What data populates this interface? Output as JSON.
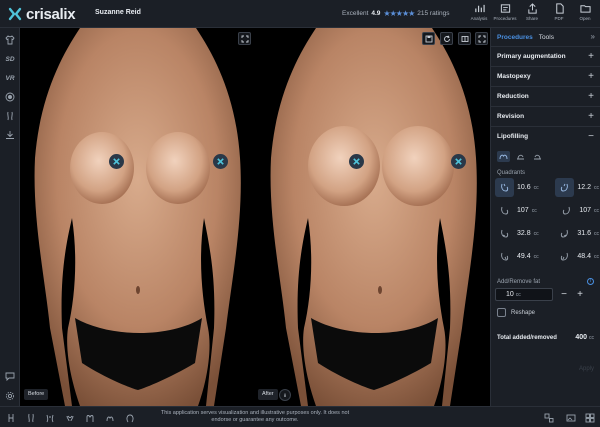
{
  "app": {
    "brand": "crisalix",
    "patient_name": "Suzanne Reid"
  },
  "rating": {
    "label": "Excellent",
    "score": "4.9",
    "stars": "★★★★★",
    "count": "215 ratings"
  },
  "toolbar": {
    "analysis": "Analysis",
    "procedures": "Procedures",
    "share": "Share",
    "pdf": "PDF",
    "open": "Open"
  },
  "leftbar": {
    "sd": "SD",
    "vr": "VR"
  },
  "viewer": {
    "before_label": "Before",
    "after_label": "After"
  },
  "panel": {
    "tabs": [
      "Procedures",
      "Tools"
    ],
    "collapse_glyph": "»",
    "sections": [
      {
        "label": "Primary augmentation",
        "toggle": "+"
      },
      {
        "label": "Mastopexy",
        "toggle": "+"
      },
      {
        "label": "Reduction",
        "toggle": "+"
      },
      {
        "label": "Revision",
        "toggle": "+"
      },
      {
        "label": "Lipofilling",
        "toggle": "−"
      }
    ],
    "quadrants_title": "Quadrants",
    "unit": "cc",
    "quadrants": [
      {
        "value": "10.6",
        "side": "left"
      },
      {
        "value": "12.2",
        "side": "right"
      },
      {
        "value": "107",
        "side": "left"
      },
      {
        "value": "107",
        "side": "right"
      },
      {
        "value": "32.8",
        "side": "left"
      },
      {
        "value": "31.6",
        "side": "right"
      },
      {
        "value": "49.4",
        "side": "left"
      },
      {
        "value": "48.4",
        "side": "right"
      }
    ],
    "add_remove_label": "Add/Remove fat",
    "add_remove_value": "10",
    "minus": "−",
    "plus": "+",
    "reshape_label": "Reshape",
    "total_label": "Total added/removed",
    "total_value": "400",
    "apply_label": "Apply"
  },
  "footer": {
    "disclaimer": "This application serves visualization and illustrative purposes only. It does not endorse or guarantee any outcome."
  },
  "colors": {
    "accent": "#4a90e2",
    "marker_fg": "#4fc3d9",
    "skin": "#c99a7b"
  }
}
